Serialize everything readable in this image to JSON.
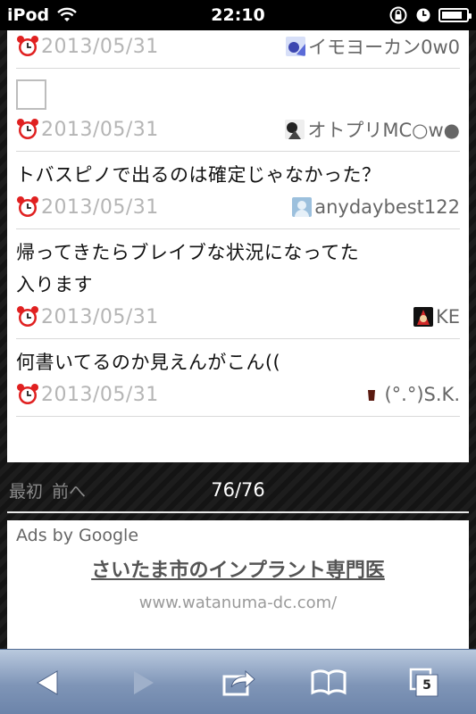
{
  "status_bar": {
    "carrier": "iPod",
    "time": "22:10"
  },
  "posts": [
    {
      "text": "",
      "date": "2013/05/31",
      "author": "イモヨーカン0w0"
    },
    {
      "text": "",
      "date": "2013/05/31",
      "author": "オトプリMC○w●"
    },
    {
      "text": "トバスピノで出るのは確定じゃなかった？",
      "date": "2013/05/31",
      "author": "anydaybest122"
    },
    {
      "text": "帰ってきたらブレイブな状況になってた\n入ります",
      "date": "2013/05/31",
      "author": "KE"
    },
    {
      "text": "何書いてるのか見えんがこん((",
      "date": "2013/05/31",
      "author": "(°.°)S.K."
    }
  ],
  "pager": {
    "first": "最初",
    "prev": "前へ",
    "count": "76/76"
  },
  "ad": {
    "label": "Ads by Google",
    "title": "さいたま市のインプラント専門医",
    "url": "www.watanuma-dc.com/"
  },
  "toolbar": {
    "tab_count": "5"
  },
  "battery_level": 0.85,
  "colors": {
    "toolbar": "#7f95b7",
    "date_text": "#b5b5b5",
    "page_bg": "#161616"
  }
}
